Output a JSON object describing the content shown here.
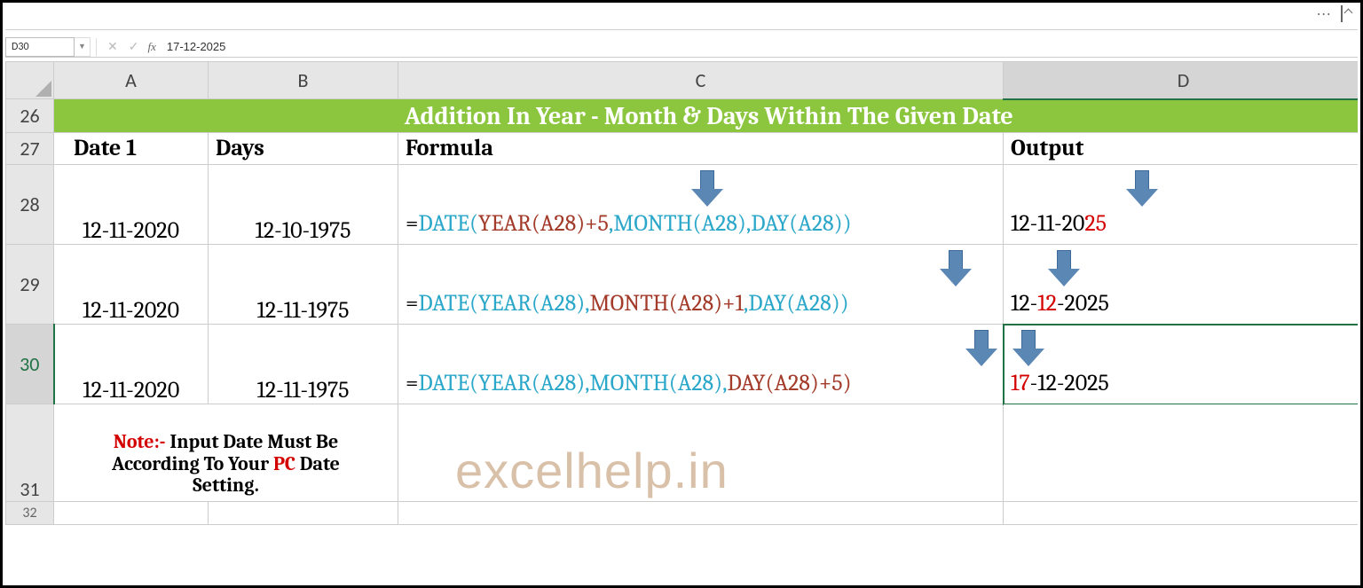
{
  "top": {
    "dots": "···"
  },
  "namebox": {
    "value": "D30"
  },
  "formulabar": {
    "fx": "fx",
    "value": "17-12-2025"
  },
  "cols": {
    "a": "A",
    "b": "B",
    "c": "C",
    "d": "D"
  },
  "rownums": {
    "r26": "26",
    "r27": "27",
    "r28": "28",
    "r29": "29",
    "r30": "30",
    "r31": "31",
    "r32": "32"
  },
  "title": "Addition In Year - Month & Days Within The Given Date",
  "headers": {
    "date1": "Date 1",
    "days": "Days",
    "formula": "Formula",
    "output": "Output"
  },
  "r28": {
    "date1": "12-11-2020",
    "days": "12-10-1975",
    "f_eq": "=",
    "f_date": "DATE(",
    "f_year": "YEAR(A28)+5",
    "f_c1": ",",
    "f_month": "MONTH(A28)",
    "f_c2": ",",
    "f_day": "DAY(A28))",
    "out_pre": "12-11-20",
    "out_hl": "25"
  },
  "r29": {
    "date1": "12-11-2020",
    "days": "12-11-1975",
    "f_eq": "=",
    "f_date": "DATE(",
    "f_year": "YEAR(A28)",
    "f_c1": ",",
    "f_month": "MONTH(A28)+1",
    "f_c2": ",",
    "f_day": "DAY(A28))",
    "out_pre": "12-",
    "out_hl": "12",
    "out_post": "-2025"
  },
  "r30": {
    "date1": "12-11-2020",
    "days": "12-11-1975",
    "f_eq": "=",
    "f_date": "DATE(",
    "f_year": "YEAR(A28)",
    "f_c1": ",",
    "f_month": "MONTH(A28)",
    "f_c2": ",",
    "f_day": "DAY(A28)+5)",
    "out_hl": "17",
    "out_post": "-12-2025"
  },
  "note": {
    "prefix": "Note:-",
    "l1": " Input Date Must Be",
    "l2": "According To Your ",
    "pc": "PC",
    "l3": " Date",
    "l4": "Setting."
  },
  "watermark": "excelhelp.in"
}
